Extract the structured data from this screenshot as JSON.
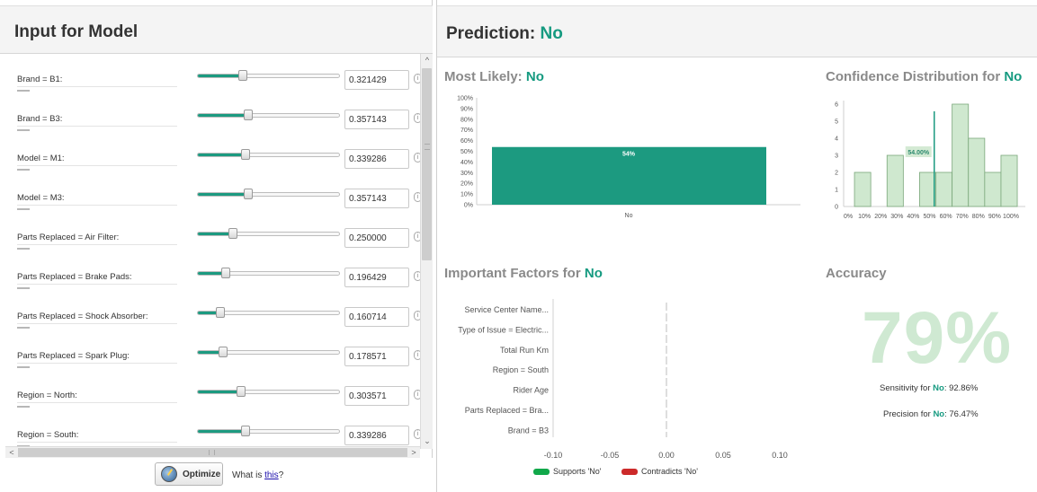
{
  "left": {
    "title": "Input for Model",
    "inputs": [
      {
        "label": "Brand = B1:",
        "value": "0.321429",
        "fraction": 0.321429
      },
      {
        "label": "Brand = B3:",
        "value": "0.357143",
        "fraction": 0.357143
      },
      {
        "label": "Model = M1:",
        "value": "0.339286",
        "fraction": 0.339286
      },
      {
        "label": "Model = M3:",
        "value": "0.357143",
        "fraction": 0.357143
      },
      {
        "label": "Parts Replaced = Air Filter:",
        "value": "0.250000",
        "fraction": 0.25
      },
      {
        "label": "Parts Replaced = Brake Pads:",
        "value": "0.196429",
        "fraction": 0.196429
      },
      {
        "label": "Parts Replaced = Shock Absorber:",
        "value": "0.160714",
        "fraction": 0.160714
      },
      {
        "label": "Parts Replaced = Spark Plug:",
        "value": "0.178571",
        "fraction": 0.178571
      },
      {
        "label": "Region = North:",
        "value": "0.303571",
        "fraction": 0.303571
      },
      {
        "label": "Region = South:",
        "value": "0.339286",
        "fraction": 0.339286
      }
    ],
    "optimize_label": "Optimize",
    "what_is_prefix": "What is ",
    "what_is_link": "this",
    "what_is_suffix": "?"
  },
  "prediction": {
    "label": "Prediction: ",
    "value": "No"
  },
  "most_likely": {
    "label": "Most Likely: ",
    "value": "No"
  },
  "confidence": {
    "label": "Confidence Distribution for ",
    "value": "No"
  },
  "factors": {
    "label": "Important Factors for ",
    "value": "No"
  },
  "accuracy": {
    "title": "Accuracy",
    "value": "79%",
    "sensitivity_label": "Sensitivity for ",
    "sensitivity_class": "No",
    "sensitivity_value": ": 92.86%",
    "precision_label": "Precision for ",
    "precision_class": "No",
    "precision_value": ": 76.47%"
  },
  "legend": {
    "supports": "Supports 'No'",
    "contradicts": "Contradicts 'No'"
  },
  "colors": {
    "accent": "#159a80",
    "bar": "#1c9a80",
    "hist_fill": "#cfe8cf",
    "hist_stroke": "#7aa77a",
    "supports": "#11a84a",
    "contradicts": "#cc2a2a",
    "accuracy": "#cfe9d2"
  },
  "chart_data": [
    {
      "type": "bar",
      "categories": [
        "No"
      ],
      "values": [
        54
      ],
      "data_labels": [
        "54%"
      ],
      "yticks": [
        "0%",
        "10%",
        "20%",
        "30%",
        "40%",
        "50%",
        "60%",
        "70%",
        "80%",
        "90%",
        "100%"
      ],
      "ylim": [
        0,
        100
      ]
    },
    {
      "type": "bar",
      "categories": [
        "0%",
        "10%",
        "20%",
        "30%",
        "40%",
        "50%",
        "60%",
        "70%",
        "80%",
        "90%",
        "100%"
      ],
      "bins": [
        {
          "start": 0.05,
          "end": 0.15,
          "value": 2
        },
        {
          "start": 0.25,
          "end": 0.35,
          "value": 3
        },
        {
          "start": 0.45,
          "end": 0.55,
          "value": 2
        },
        {
          "start": 0.55,
          "end": 0.65,
          "value": 2
        },
        {
          "start": 0.65,
          "end": 0.75,
          "value": 6
        },
        {
          "start": 0.75,
          "end": 0.85,
          "value": 4
        },
        {
          "start": 0.85,
          "end": 0.95,
          "value": 2
        },
        {
          "start": 0.95,
          "end": 1.05,
          "value": 3
        }
      ],
      "marker": 0.54,
      "marker_label": "54.00%",
      "yticks": [
        "0",
        "1",
        "2",
        "3",
        "4",
        "5",
        "6"
      ],
      "ylim": [
        0,
        6
      ],
      "xlim": [
        0,
        1
      ]
    },
    {
      "type": "bar",
      "orientation": "horizontal",
      "categories": [
        "Service Center Name...",
        "Type of Issue = Electric...",
        "Total Run Km",
        "Region = South",
        "Rider Age",
        "Parts Replaced = Bra...",
        "Brand = B3"
      ],
      "values": [
        0,
        0,
        0,
        0,
        0,
        0,
        0
      ],
      "xticks": [
        "-0.10",
        "-0.05",
        "0.00",
        "0.05",
        "0.10"
      ],
      "xlim": [
        -0.1,
        0.1
      ]
    }
  ]
}
